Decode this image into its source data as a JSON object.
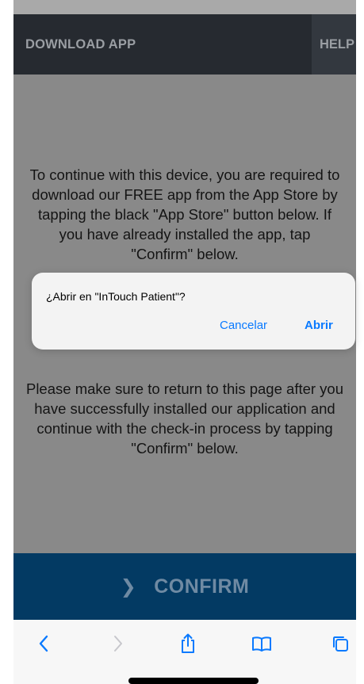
{
  "topnav": {
    "download_label": "DOWNLOAD APP",
    "help_label": "HELP"
  },
  "content": {
    "paragraph1": "To continue with this device, you are required to download our FREE app from the App Store by tapping the black \"App Store\" button below. If you have already installed the app, tap \"Confirm\" below.",
    "paragraph2": "Please make sure to return to this page after you have successfully installed our application and continue with the check-in process by tapping \"Confirm\" below."
  },
  "confirm": {
    "label": "CONFIRM"
  },
  "alert": {
    "title": "¿Abrir en \"InTouch Patient\"?",
    "cancel_label": "Cancelar",
    "open_label": "Abrir"
  },
  "toolbar": {
    "icons": [
      "chevron-left-icon",
      "chevron-right-icon",
      "share-icon",
      "book-icon",
      "tabs-icon"
    ]
  },
  "colors": {
    "nav_bg": "#262a30",
    "overlay_bg": "#898989",
    "confirm_bg": "#033a63",
    "ios_blue": "#0a7aff"
  }
}
